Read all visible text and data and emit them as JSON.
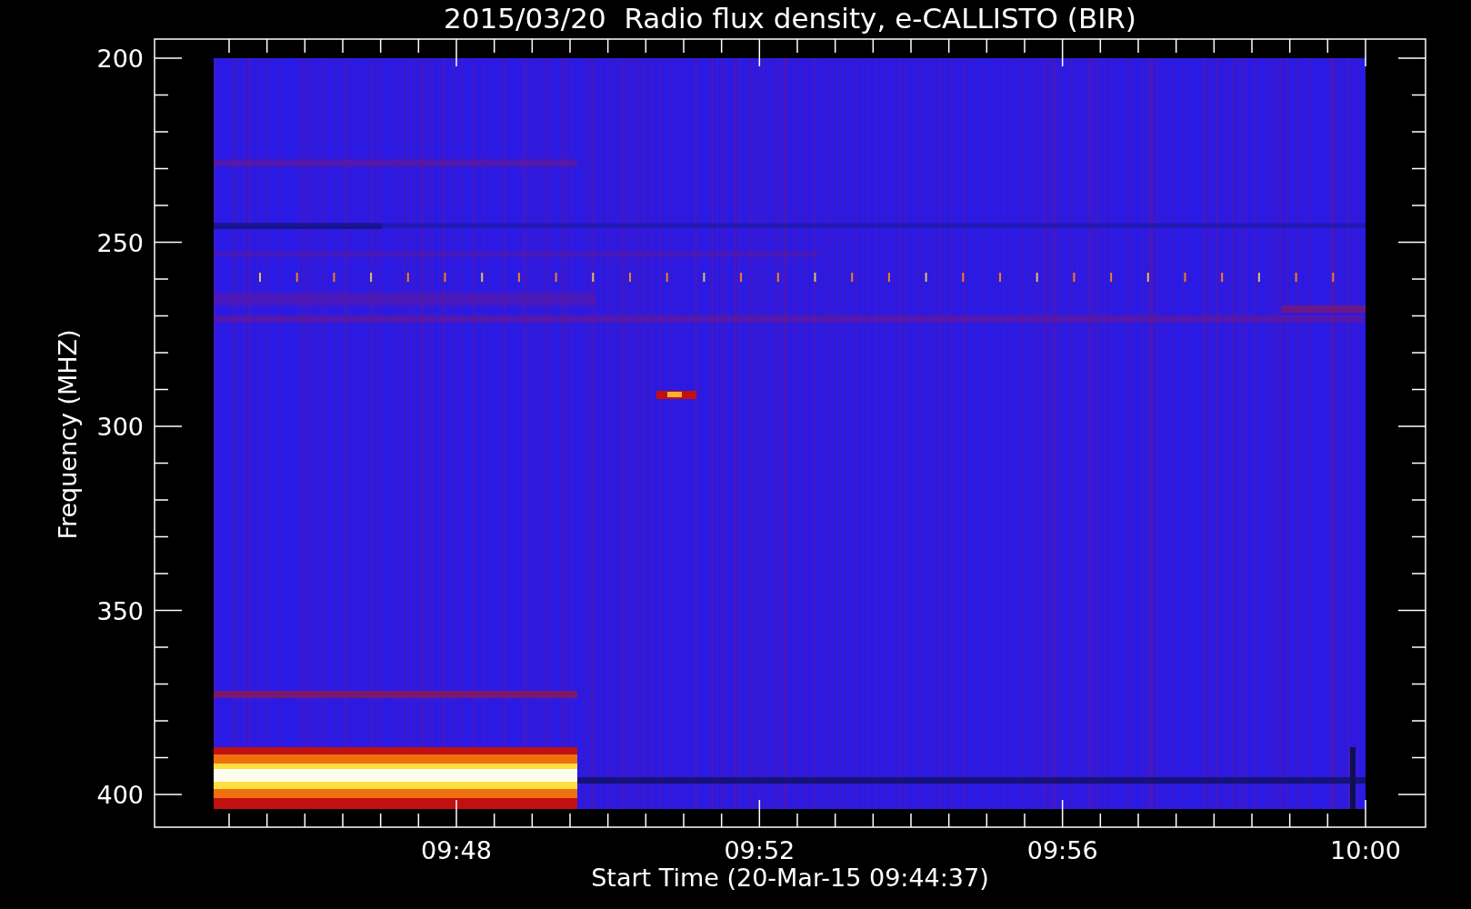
{
  "title": "2015/03/20  Radio flux density, e-CALLISTO (BIR)",
  "y_axis": {
    "label": "Frequency (MHZ)",
    "ticks": [
      "200",
      "250",
      "300",
      "350",
      "400"
    ]
  },
  "x_axis": {
    "label": "Start Time (20-Mar-15 09:44:37)",
    "ticks": [
      "09:48",
      "09:52",
      "09:56",
      "10:00"
    ]
  }
}
